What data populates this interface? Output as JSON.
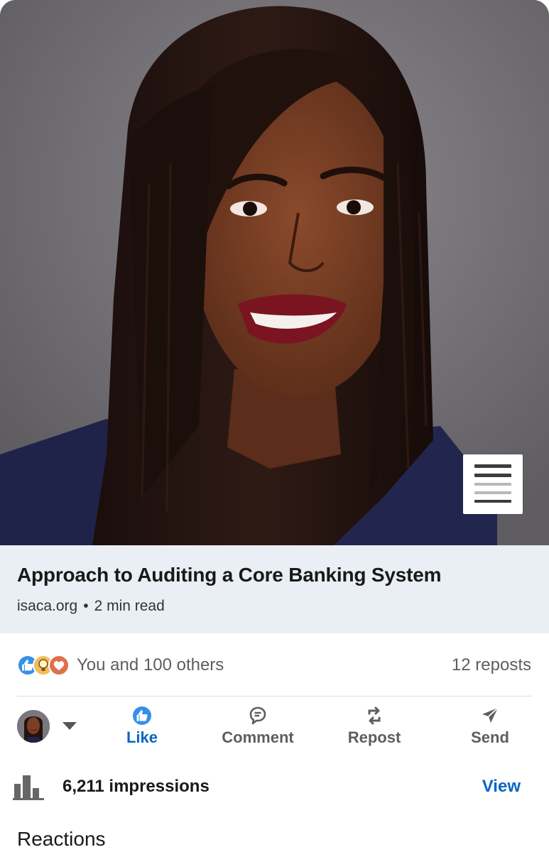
{
  "article": {
    "title": "Approach to Auditing a Core Banking System",
    "source": "isaca.org",
    "separator": "•",
    "read_time": "2 min read",
    "image_icon": "document-lines-icon"
  },
  "social": {
    "reaction_icons": [
      "like-icon",
      "insightful-icon",
      "love-icon"
    ],
    "reactors_text": "You and 100 others",
    "reposts_text": "12 reposts"
  },
  "actions": {
    "like": "Like",
    "comment": "Comment",
    "repost": "Repost",
    "send": "Send"
  },
  "stats": {
    "impressions_text": "6,211 impressions",
    "view_label": "View"
  },
  "section": {
    "reactions_heading": "Reactions"
  },
  "colors": {
    "brand_blue": "#0a66c2",
    "card_bg": "#eaeff5",
    "text_secondary": "#5e5e5e"
  }
}
